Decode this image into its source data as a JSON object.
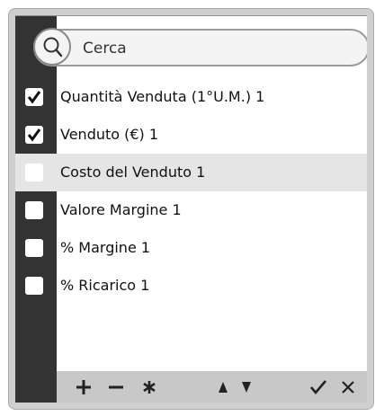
{
  "search": {
    "placeholder": "Cerca"
  },
  "items": [
    {
      "label": "Quantità Venduta (1°U.M.) 1",
      "checked": true
    },
    {
      "label": "Venduto (€) 1",
      "checked": true
    },
    {
      "label": "Costo del Venduto 1",
      "checked": false
    },
    {
      "label": "Valore Margine 1",
      "checked": false
    },
    {
      "label": "% Margine 1",
      "checked": false
    },
    {
      "label": "% Ricarico 1",
      "checked": false
    }
  ],
  "toolbar": [
    "plus-icon",
    "minus-icon",
    "asterisk-icon",
    "arrow-up-icon",
    "arrow-down-icon",
    "checkmark-icon",
    "close-icon"
  ]
}
